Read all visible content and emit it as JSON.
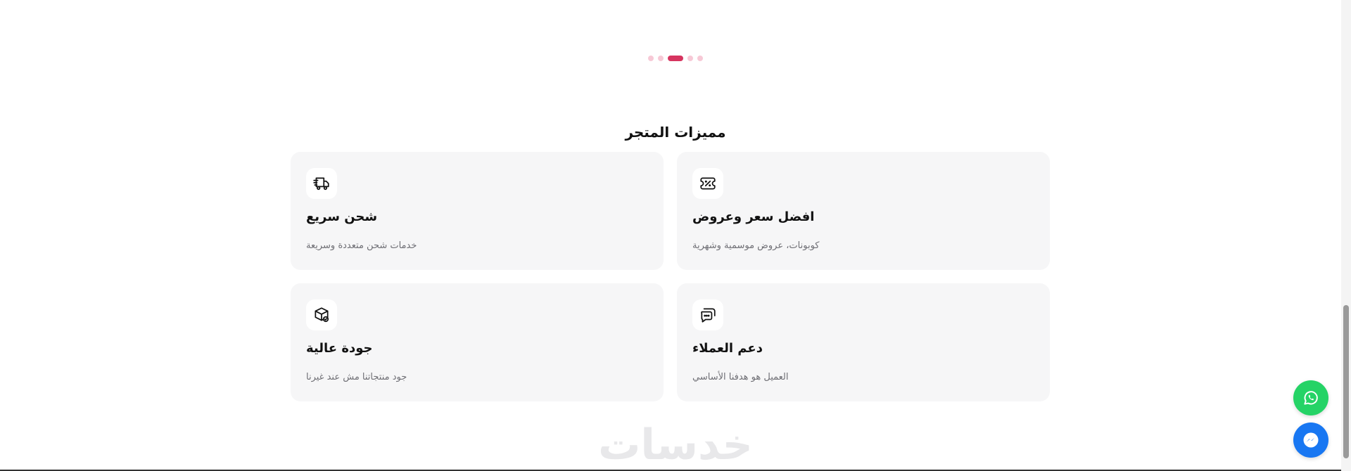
{
  "carousel": {
    "dot_count": 5,
    "active_index": 2
  },
  "features": {
    "title": "مميزات المتجر",
    "items": [
      {
        "title": "افضل سعر وعروض",
        "description": "كوبونات، عروض موسمية وشهرية",
        "icon": "discount-ticket-icon"
      },
      {
        "title": "شحن سريع",
        "description": "خدمات شحن متعددة وسريعة",
        "icon": "fast-delivery-truck-icon"
      },
      {
        "title": "دعم العملاء",
        "description": "العميل هو هدفنا الأساسي",
        "icon": "chat-bubbles-icon"
      },
      {
        "title": "جودة عالية",
        "description": "جود منتجاتنا مش عند غيرنا",
        "icon": "verified-box-icon"
      }
    ]
  },
  "footer": {
    "logo_text": "خدسات"
  },
  "floating_buttons": {
    "whatsapp_icon": "whatsapp-icon",
    "messenger_icon": "messenger-icon"
  },
  "colors": {
    "accent": "#d6345f",
    "accent_light": "#f7c9d6",
    "whatsapp": "#25d366",
    "messenger": "#1877f2",
    "card_bg": "#f6f6f7"
  }
}
